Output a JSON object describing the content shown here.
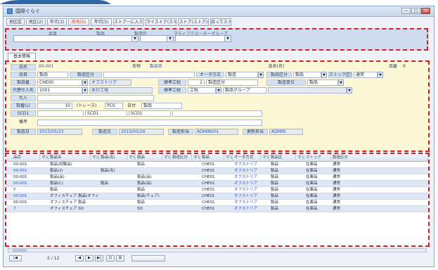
{
  "window": {
    "title": "国際ぐらぐ",
    "min": "—",
    "max": "□",
    "close": "×"
  },
  "toolbar": {
    "buttons": [
      "地区定",
      "地区(2)",
      "年代(3)",
      "所有(5)",
      "年代(5)",
      "ストアーに入り(6)",
      "マイストア(ストア)",
      "ストア(ストア)",
      "戻ってスト"
    ]
  },
  "filter": {
    "labels": [
      "品目",
      "製品",
      "製造区",
      "マディフクスーターグループ"
    ],
    "dropdown_mark": "▼"
  },
  "tab": {
    "label": "基本情報"
  },
  "form": {
    "row1": {
      "label1": "品名",
      "value1": "00-001",
      "label2": "名称",
      "value2": "製品名",
      "label3": "品名(名)",
      "label4": "品番",
      "value4": "0"
    },
    "row2": {
      "label1": "品目",
      "value1": "製品",
      "label2": "製造区分",
      "label3": "オーダ方式",
      "value3": "製造",
      "label4": "製品区分",
      "value4": "製品",
      "label5": "ストック区分",
      "value5": "通常"
    },
    "row3": {
      "label1": "製品番",
      "value1": "CHE00",
      "value1b": "オフストリア",
      "label2": "標準工程",
      "value2": "1",
      "label3": "製造区分",
      "label4": "製造単位",
      "value4": "製品"
    },
    "row4": {
      "label1": "代替仕入先",
      "value1": "1001",
      "value1b": "本社工場",
      "label2": "標準工程",
      "value2": "工程",
      "label3": "製品グループ"
    },
    "row5": {
      "label1": "仕入"
    },
    "row6": {
      "label1": "製番(L)",
      "value1": "10",
      "value1b": "(トレース)",
      "value1c": "PCS",
      "label2": "日付",
      "value2": "製品"
    },
    "row7": {
      "label1": "SCD1",
      "value1": "SCD1",
      "value2": "SCD1"
    },
    "row8": {
      "label1": "備考"
    },
    "row9": {
      "label1": "製造日",
      "value1": "2015/05/23",
      "label2": "製造日",
      "value2": "2015/05/26",
      "label3": "製造担当",
      "value3": "ADMIN001",
      "label4": "更新担当",
      "value4": "ADMIN"
    }
  },
  "grid": {
    "headers": [
      "品目",
      "マシ",
      "製品名",
      "マシ",
      "製品(名)",
      "マシ",
      "製品",
      "マシ",
      "製造区分",
      "マシ",
      "製品",
      "マシ",
      "オーダ方式",
      "マシ",
      "製品区",
      "マシ",
      "ストック",
      "製造区分"
    ],
    "rows": [
      [
        "00-001",
        "製品(試験品)",
        "",
        "製品",
        "CHE01",
        "オフストリア",
        "製品",
        "在庫品",
        "通常"
      ],
      [
        "00-001",
        "製品(2)",
        "製品(名)",
        "",
        "CHE01",
        "オフストリア",
        "製品",
        "在庫品",
        "通常"
      ],
      [
        "00-001",
        "製品(品)",
        "",
        "製品(品)",
        "CHE01",
        "オフストリア",
        "製品",
        "在庫品",
        "通常"
      ],
      [
        "00-001",
        "製品(C)",
        "製品",
        "製品(品)",
        "CHE01",
        "オフストリア",
        "製品",
        "在庫品",
        "通常"
      ],
      [
        "Y",
        "製品",
        "",
        "製品",
        "CHE01",
        "オフストリア",
        "製品",
        "在庫品",
        "通常"
      ],
      [
        "00-001",
        "オフィスチェア 製品(オフィス)",
        "",
        "製品(チェア)",
        "CHE01",
        "オフストリア",
        "製品",
        "在庫品",
        "通常"
      ],
      [
        "00-001",
        "オフィスチェア 製品",
        "",
        "製品",
        "CHE01",
        "オフストリア",
        "製品",
        "在庫品",
        "通常"
      ],
      [
        "7",
        "オフィスチェア SO",
        "",
        "SO",
        "CHE01",
        "オフストリア",
        "製品",
        "在庫品",
        "通常"
      ]
    ]
  },
  "status": {
    "page": "2 / 12",
    "icons": [
      "|◀",
      "◀",
      "▶",
      "▶|",
      "⊡",
      "⊞"
    ]
  }
}
